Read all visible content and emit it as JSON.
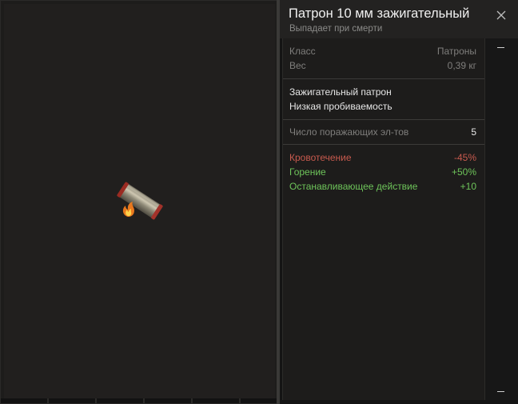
{
  "item": {
    "title": "Патрон 10 мм зажигательный",
    "subtitle": "Выпадает при смерти",
    "icon": "incendiary-bullet-icon"
  },
  "info": [
    {
      "label": "Класс",
      "value": "Патроны"
    },
    {
      "label": "Вес",
      "value": "0,39 кг"
    }
  ],
  "description": [
    "Зажигательный патрон",
    "Низкая пробиваемость"
  ],
  "damage_elements": {
    "label": "Число поражающих эл-тов",
    "value": "5"
  },
  "effects": [
    {
      "label": "Кровотечение",
      "value": "-45%",
      "color": "#c85a4e"
    },
    {
      "label": "Горение",
      "value": "+50%",
      "color": "#6ec45a"
    },
    {
      "label": "Останавливающее действие",
      "value": "+10",
      "color": "#6ec45a"
    }
  ],
  "controls": {
    "close_icon": "close-icon",
    "scroll_up_icon": "minus-icon",
    "scroll_down_icon": "minus-icon"
  }
}
